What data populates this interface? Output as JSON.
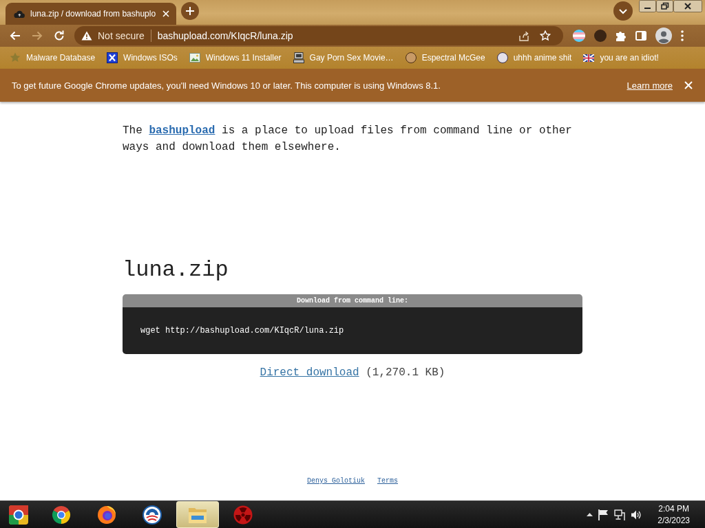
{
  "browser": {
    "tabs": [
      {
        "title": "luna.zip / download from bashuplo",
        "selected": true
      }
    ],
    "nav_buttons": [
      {
        "disabled": false
      },
      {
        "disabled": true
      },
      {
        "disabled": false
      }
    ],
    "address_bar": {
      "security_label": "Not secure",
      "url": "bashupload.com/KIqcR/luna.zip"
    },
    "bookmarks": [
      {
        "label": "Malware Database"
      },
      {
        "label": "Windows ISOs"
      },
      {
        "label": "Windows 11 Installer"
      },
      {
        "label": "Gay Porn Sex Movie…"
      },
      {
        "label": "Espectral McGee"
      },
      {
        "label": "uhhh anime shit"
      },
      {
        "label": "you are an idiot!"
      }
    ],
    "infobar": {
      "message": "To get future Google Chrome updates, you'll need Windows 10 or later. This computer is using Windows 8.1.",
      "link": "Learn more"
    }
  },
  "page": {
    "intro": {
      "before": "The",
      "link": "bashupload",
      "after": "is a place to upload files from command line or other ways and download them elsewhere."
    },
    "file_name": "luna.zip",
    "command_box": {
      "header": "Download from command line:",
      "command": "wget http://bashupload.com/KIqcR/luna.zip"
    },
    "download": {
      "link": "Direct download",
      "size": "(1,270.1 KB)"
    },
    "footer_links": [
      "Denys Golotiuk",
      "Terms"
    ]
  },
  "taskbar": {
    "apps": [
      {
        "selected": false
      },
      {
        "selected": false
      },
      {
        "selected": false
      },
      {
        "selected": false
      },
      {
        "selected": true
      },
      {
        "selected": false
      }
    ],
    "time": "2:04 PM",
    "date": "2/3/2023"
  }
}
